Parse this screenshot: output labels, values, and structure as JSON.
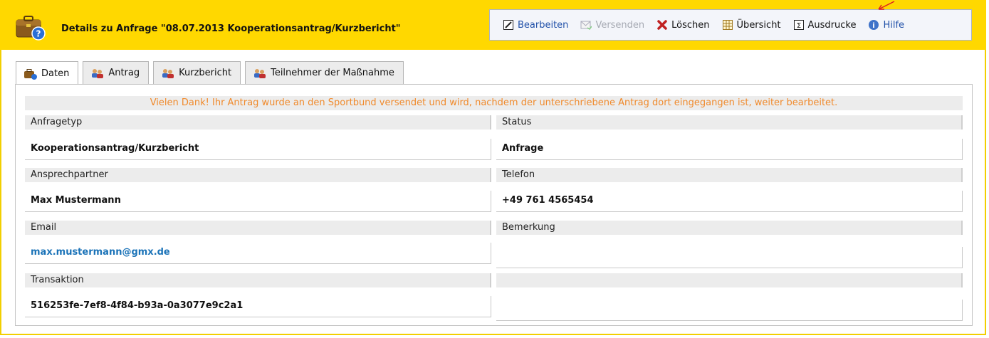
{
  "header": {
    "title": "Details zu  Anfrage \"08.07.2013 Kooperationsantrag/Kurzbericht\""
  },
  "toolbar": {
    "edit": "Bearbeiten",
    "send": "Versenden",
    "delete": "Löschen",
    "overview": "Übersicht",
    "print": "Ausdrucke",
    "help": "Hilfe"
  },
  "tabs": [
    {
      "label": "Daten"
    },
    {
      "label": "Antrag"
    },
    {
      "label": "Kurzbericht"
    },
    {
      "label": "Teilnehmer der Maßnahme"
    }
  ],
  "notice": "Vielen Dank! Ihr Antrag wurde an den Sportbund versendet und wird, nachdem der unterschriebene Antrag dort eingegangen ist, weiter bearbeitet.",
  "fields": {
    "anfragetyp": {
      "label": "Anfragetyp",
      "value": "Kooperationsantrag/Kurzbericht"
    },
    "status": {
      "label": "Status",
      "value": "Anfrage"
    },
    "ansprechpartner": {
      "label": "Ansprechpartner",
      "value": "Max Mustermann"
    },
    "telefon": {
      "label": "Telefon",
      "value": "+49 761 4565454"
    },
    "email": {
      "label": "Email",
      "value": "max.mustermann@gmx.de"
    },
    "bemerkung": {
      "label": "Bemerkung",
      "value": ""
    },
    "transaktion": {
      "label": "Transaktion",
      "value": "516253fe-7ef8-4f84-b93a-0a3077e9c2a1"
    },
    "empty": {
      "label": "",
      "value": ""
    }
  },
  "colors": {
    "header": "#ffd800",
    "notice_text": "#f08a2c",
    "link": "#1b73b8",
    "label_bg": "#ececec"
  }
}
